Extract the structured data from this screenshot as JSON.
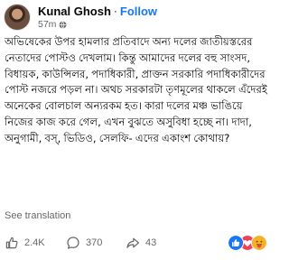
{
  "post": {
    "author": "Kunal Ghosh",
    "separator": "·",
    "follow_label": "Follow",
    "time": "57m",
    "privacy_icon": "globe-icon",
    "body": "অভিষেকের উপর হামলার প্রতিবাদে অন্য দলের জাতীয়স্তরের নেতাদের পোস্টও দেখলাম। কিন্তু আমাদের দলের বহু সাংসদ, বিধায়ক, কাউন্সিলর, পদাধিকারী, প্রাক্তন সরকারি পদাধিকারীদের পোস্ট নজরে পড়ল না। অথচ সরকারটা তৃণমূলের থাকলে এঁদেরই অনেকের বোলচাল অন্যরকম হত। কারা দলের মঞ্চ ভাঙিয়ে নিজের কাজ করে গেল, এখন বুঝতে অসুবিধা হচ্ছে না। দাদা, অনুগামী, বস্‌, ভিডিও, সেলফি- এদের একাংশ কোথায়?",
    "see_translation": "See translation"
  },
  "footer": {
    "likes": "2.4K",
    "comments": "370",
    "shares": "43",
    "icons": [
      "like-icon",
      "comment-icon",
      "share-icon"
    ],
    "reactions": [
      "like-reaction",
      "love-reaction",
      "care-reaction"
    ]
  },
  "colors": {
    "follow": "#1877f2",
    "meta": "#65676b",
    "text": "#050505",
    "like": "#1877f2",
    "love": "#f33e58",
    "care": "#f7b125"
  }
}
